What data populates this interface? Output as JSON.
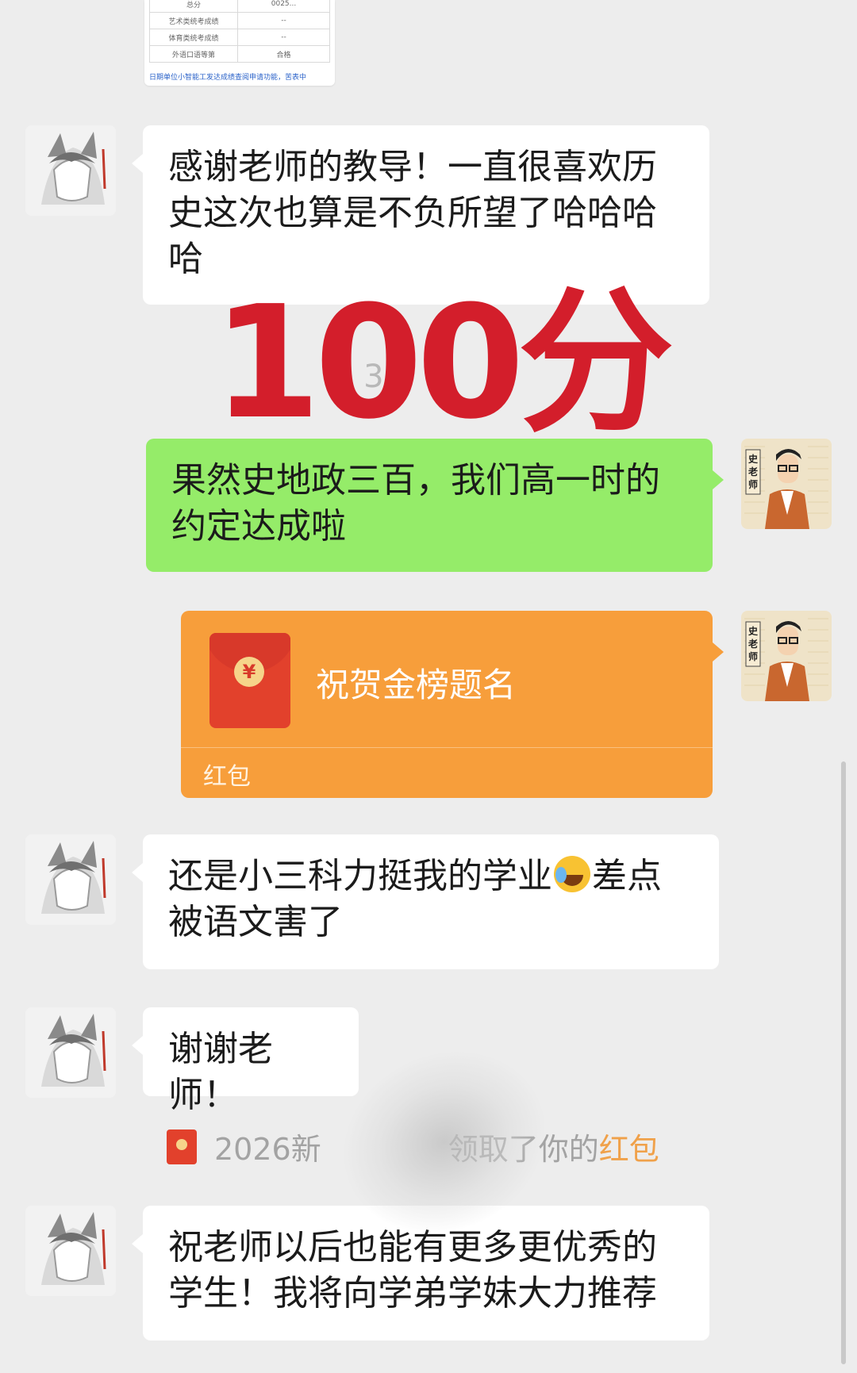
{
  "doc_snippet": {
    "rows": [
      {
        "label": "总分",
        "value": "0025..."
      },
      {
        "label": "艺术类统考成绩",
        "value": "--"
      },
      {
        "label": "体育类统考成绩",
        "value": "--"
      },
      {
        "label": "外语口语等第",
        "value": "合格"
      }
    ],
    "footnote": "日期单位小智能工发达成绩查阅申请功能，苦表中"
  },
  "overlay": {
    "score_text": "100分",
    "timestamp_fragment": "2 30"
  },
  "messages": [
    {
      "side": "left",
      "sender": "student",
      "text": "感谢老师的教导！一直很喜欢历史这次也算是不负所望了哈哈哈哈"
    },
    {
      "side": "right",
      "sender": "teacher",
      "text": "果然史地政三百，我们高一时的约定达成啦"
    },
    {
      "side": "right",
      "sender": "teacher",
      "type": "red_packet",
      "title": "祝贺金榜题名",
      "label": "红包"
    },
    {
      "side": "left",
      "sender": "student",
      "text_before": "还是小三科力挺我的学业",
      "emoji": "loudly-crying-face",
      "text_after": "差点被语文害了"
    },
    {
      "side": "left",
      "sender": "student",
      "text": "谢谢老师！"
    },
    {
      "side": "left",
      "sender": "student",
      "text": "祝老师以后也能有更多更优秀的学生！我将向学弟学妹大力推荐"
    }
  ],
  "system_notice": {
    "prefix": "2026新",
    "middle": "领取了你的",
    "accent": "红包"
  },
  "avatars": {
    "student_icon": "anime-avatar-icon",
    "teacher_icon": "teacher-avatar-icon",
    "teacher_badge": "史老师"
  },
  "colors": {
    "background": "#ededed",
    "bubble_self": "#95ec69",
    "bubble_other": "#ffffff",
    "red_packet": "#f79e3b",
    "score_red": "#d31e2b"
  }
}
